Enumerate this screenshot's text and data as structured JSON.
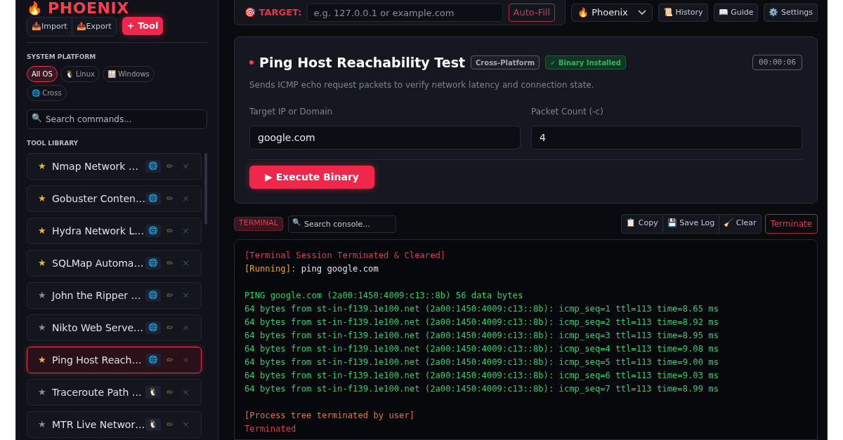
{
  "sidebar": {
    "logo": {
      "icon": "🔥",
      "title": "PHOENIX"
    },
    "actions": [
      {
        "icon": "📥",
        "label": "Import",
        "kind": "plain"
      },
      {
        "icon": "📤",
        "label": "Export",
        "kind": "plain"
      },
      {
        "label": "+ Tool",
        "kind": "primary"
      }
    ],
    "platform_heading": "SYSTEM PLATFORM",
    "platforms": [
      {
        "label": "All OS",
        "selected": true
      },
      {
        "icon": "🐧",
        "label": "Linux",
        "selected": false
      },
      {
        "icon": "🪟",
        "label": "Windows",
        "selected": false
      },
      {
        "icon": "🌐",
        "label": "Cross",
        "selected": false
      }
    ],
    "search": {
      "icon": "🔍",
      "placeholder": "Search commands..."
    },
    "library_heading": "TOOL LIBRARY",
    "tools": [
      {
        "star": "★",
        "starred": true,
        "name": "Nmap Network …",
        "platform": "🌐",
        "selected": false
      },
      {
        "star": "★",
        "starred": true,
        "name": "Gobuster Conten…",
        "platform": "🌐",
        "selected": false
      },
      {
        "star": "★",
        "starred": true,
        "name": "Hydra Network L…",
        "platform": "🌐",
        "selected": false
      },
      {
        "star": "★",
        "starred": true,
        "name": "SQLMap Automa…",
        "platform": "🌐",
        "selected": false
      },
      {
        "star": "★",
        "starred": false,
        "name": "John the Ripper …",
        "platform": "🌐",
        "selected": false
      },
      {
        "star": "★",
        "starred": false,
        "name": "Nikto Web Serve…",
        "platform": "🌐",
        "selected": false
      },
      {
        "star": "★",
        "starred": true,
        "name": "Ping Host Reach…",
        "platform": "🌐",
        "selected": true
      },
      {
        "star": "★",
        "starred": false,
        "name": "Traceroute Path …",
        "platform": "🐧",
        "selected": false
      },
      {
        "star": "★",
        "starred": false,
        "name": "MTR Live Networ…",
        "platform": "🐧",
        "selected": false
      }
    ],
    "edit_icon": "✏",
    "delete_icon": "×"
  },
  "topbar": {
    "target_label": "🎯 TARGET:",
    "target_placeholder": "e.g. 127.0.0.1 or example.com",
    "autofill": "Auto-Fill",
    "profile": {
      "icon": "🔥",
      "label": "Phoenix"
    },
    "buttons": [
      {
        "icon": "📜",
        "label": "History"
      },
      {
        "icon": "📖",
        "label": "Guide"
      },
      {
        "icon": "⚙️",
        "label": "Settings"
      }
    ]
  },
  "tool": {
    "title": "Ping Host Reachability Test",
    "badges": [
      {
        "label": "Cross-Platform",
        "kind": "neutral"
      },
      {
        "label": "✓ Binary Installed",
        "kind": "success"
      }
    ],
    "timer": "00:00:06",
    "description": "Sends ICMP echo request packets to verify network latency and connection state.",
    "fields": [
      {
        "label": "Target IP or Domain",
        "value": "google.com"
      },
      {
        "label": "Packet Count (-c)",
        "value": "4"
      }
    ],
    "execute": "▶ Execute Binary"
  },
  "terminal": {
    "tag": "TERMINAL",
    "search_icon": "🔍",
    "search_placeholder": "Search console...",
    "actions": [
      {
        "icon": "📋",
        "label": "Copy"
      },
      {
        "icon": "💾",
        "label": "Save Log"
      },
      {
        "icon": "🧹",
        "label": "Clear"
      }
    ],
    "terminate": "Terminate",
    "lines": [
      {
        "kind": "error",
        "text": "[Terminal Session Terminated & Cleared]"
      },
      {
        "kind": "command",
        "label": "[Running]:",
        "text": " ping google.com"
      },
      {
        "kind": "blank"
      },
      {
        "kind": "output",
        "text": "PING google.com (2a00:1450:4009:c13::8b) 56 data bytes"
      },
      {
        "kind": "output",
        "text": "64 bytes from st-in-f139.1e100.net (2a00:1450:4009:c13::8b): icmp_seq=1 ttl=113 time=8.65 ms"
      },
      {
        "kind": "output",
        "text": "64 bytes from st-in-f139.1e100.net (2a00:1450:4009:c13::8b): icmp_seq=2 ttl=113 time=8.92 ms"
      },
      {
        "kind": "output",
        "text": "64 bytes from st-in-f139.1e100.net (2a00:1450:4009:c13::8b): icmp_seq=3 ttl=113 time=8.95 ms"
      },
      {
        "kind": "output",
        "text": "64 bytes from st-in-f139.1e100.net (2a00:1450:4009:c13::8b): icmp_seq=4 ttl=113 time=9.08 ms"
      },
      {
        "kind": "output",
        "text": "64 bytes from st-in-f139.1e100.net (2a00:1450:4009:c13::8b): icmp_seq=5 ttl=113 time=9.00 ms"
      },
      {
        "kind": "output",
        "text": "64 bytes from st-in-f139.1e100.net (2a00:1450:4009:c13::8b): icmp_seq=6 ttl=113 time=9.03 ms"
      },
      {
        "kind": "output",
        "text": "64 bytes from st-in-f139.1e100.net (2a00:1450:4009:c13::8b): icmp_seq=7 ttl=113 time=8.99 ms"
      },
      {
        "kind": "blank"
      },
      {
        "kind": "warn",
        "text": "[Process tree terminated by user]"
      },
      {
        "kind": "error",
        "text": "Terminated"
      }
    ]
  }
}
